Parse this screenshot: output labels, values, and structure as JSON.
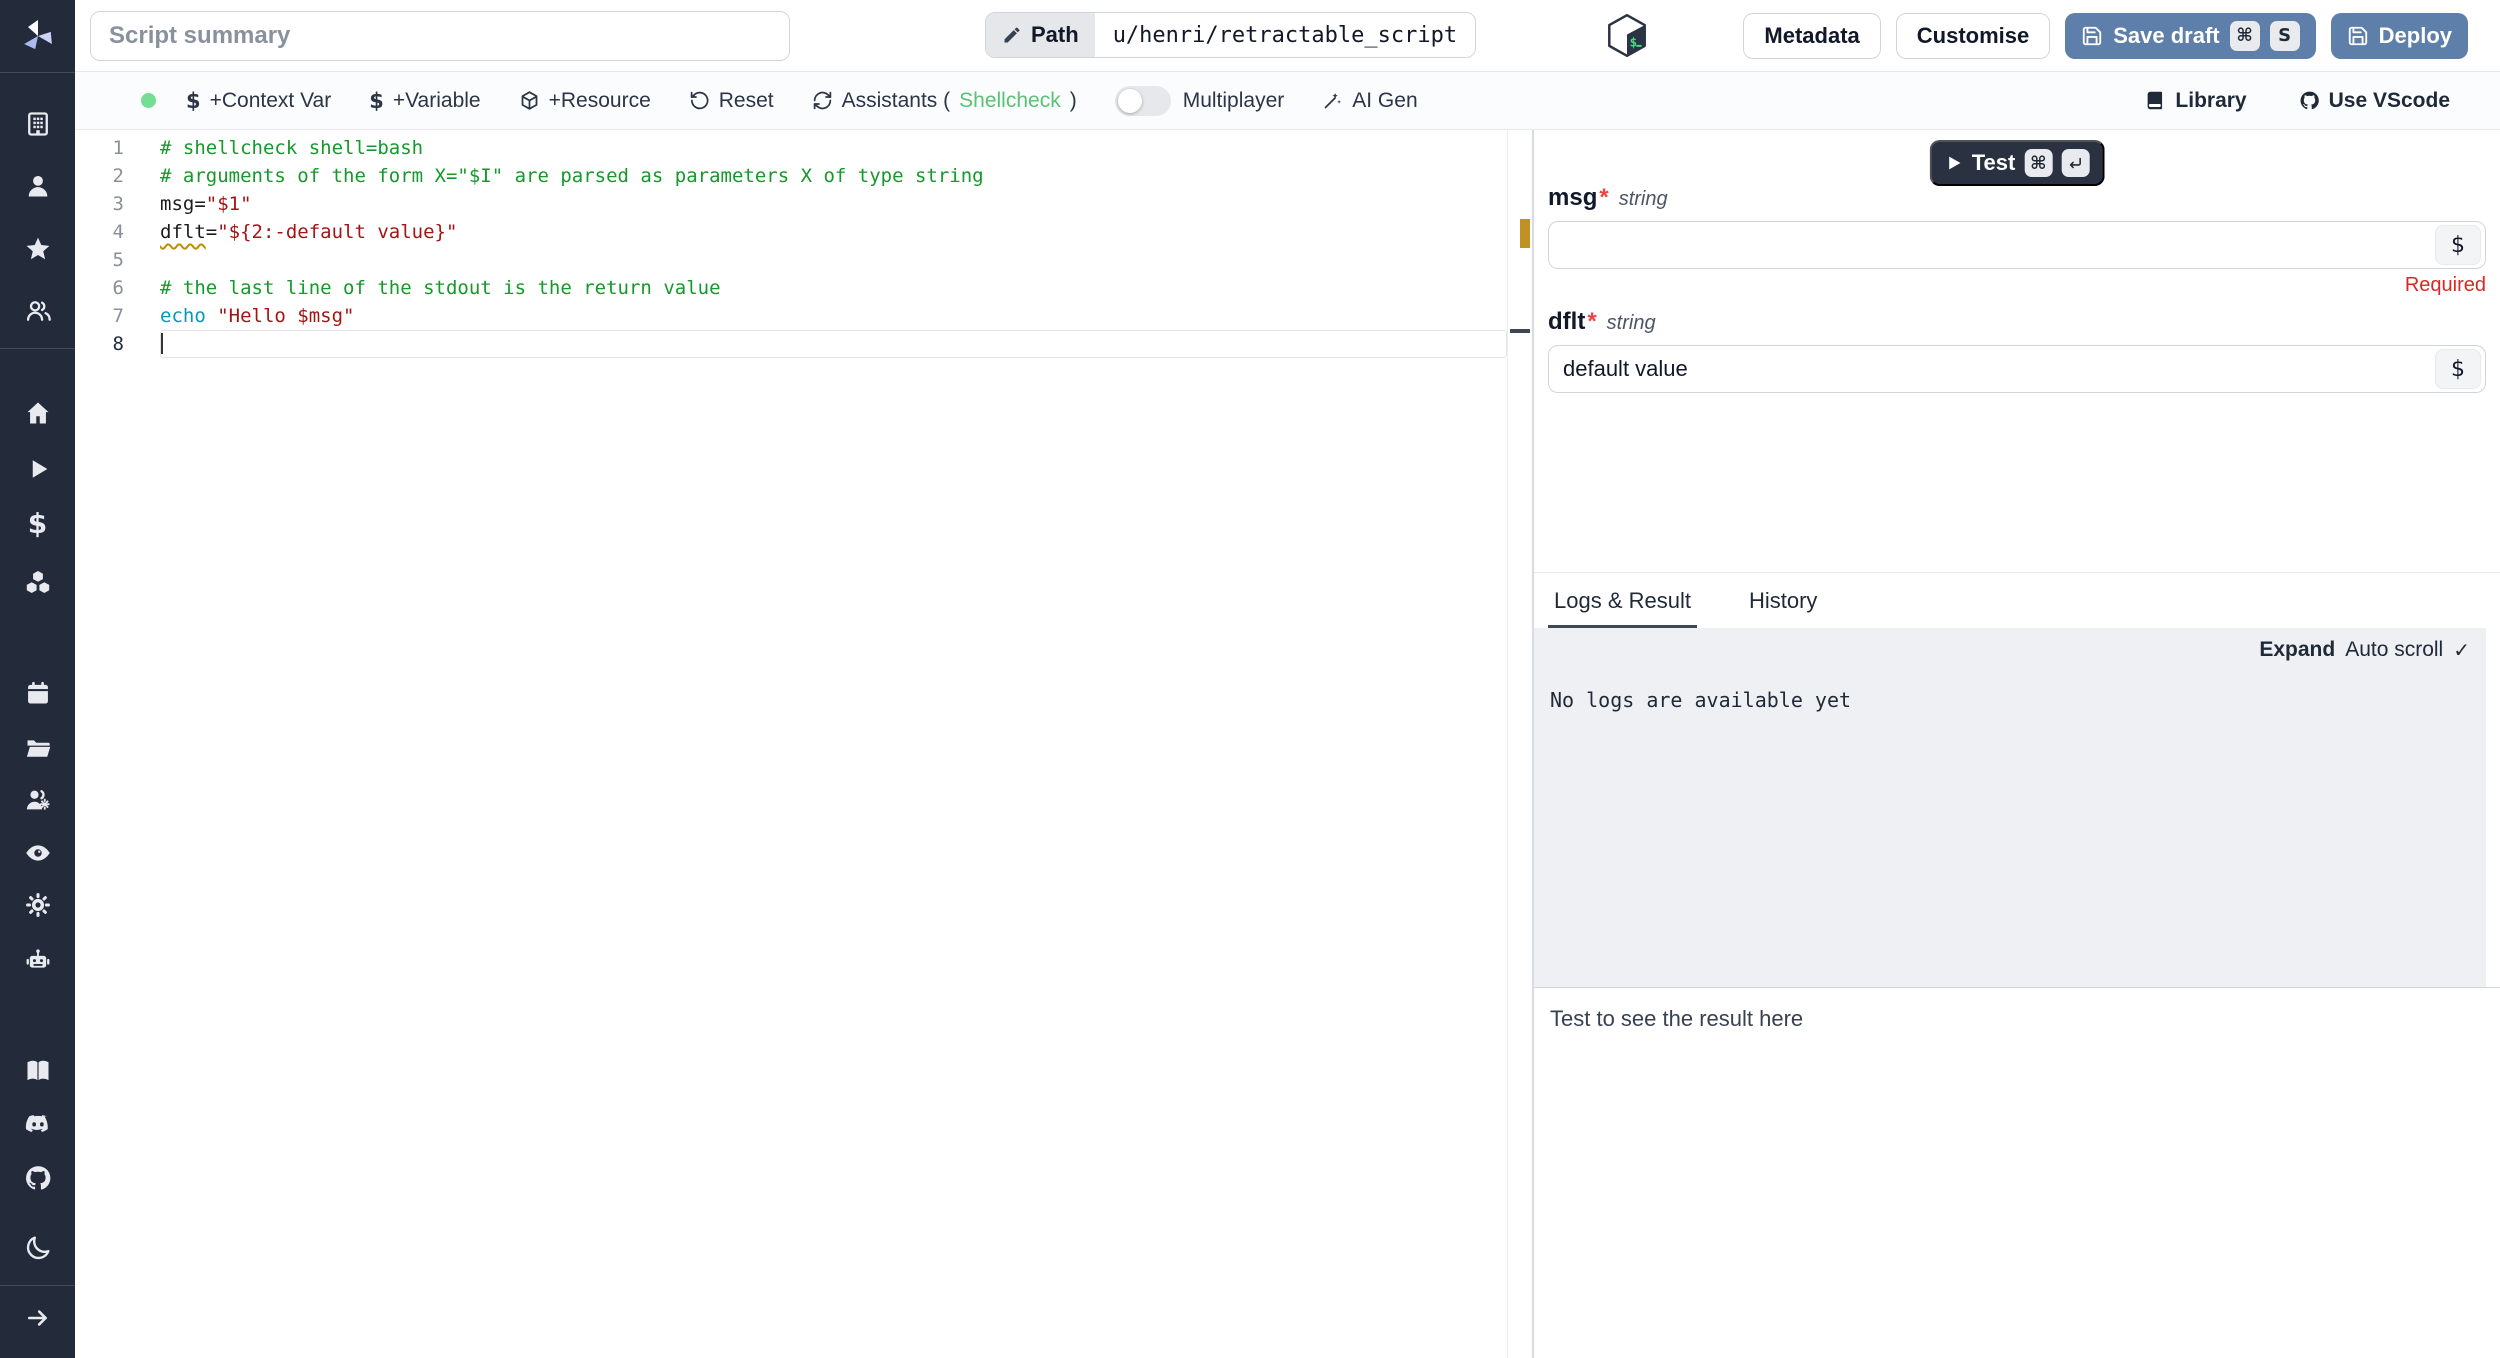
{
  "topbar": {
    "summary_placeholder": "Script summary",
    "path_label": "Path",
    "path_value": "u/henri/retractable_script",
    "metadata_label": "Metadata",
    "customise_label": "Customise",
    "save_draft_label": "Save draft",
    "deploy_label": "Deploy",
    "kbd_cmd": "⌘",
    "kbd_s": "S"
  },
  "toolbar": {
    "dollar_glyph": "$",
    "context_var_label": "+Context Var",
    "variable_label": "+Variable",
    "resource_label": "+Resource",
    "reset_label": "Reset",
    "assistants_prefix": "Assistants (",
    "assistants_name": "Shellcheck",
    "assistants_suffix": ")",
    "multiplayer_label": "Multiplayer",
    "ai_gen_label": "AI Gen",
    "library_label": "Library",
    "vscode_label": "Use VScode"
  },
  "editor": {
    "language": "bash",
    "line_numbers": [
      "1",
      "2",
      "3",
      "4",
      "5",
      "6",
      "7",
      "8"
    ],
    "lines": {
      "l1": "# shellcheck shell=bash",
      "l2": "# arguments of the form X=\"$I\" are parsed as parameters X of type string",
      "l3_var": "msg=",
      "l3_str": "\"$1\"",
      "l4_warn": "dflt",
      "l4_eq": "=",
      "l4_str": "\"${2:-default value}\"",
      "l6": "# the last line of the stdout is the return value",
      "l7_cmd": "echo",
      "l7_sp": " ",
      "l7_str": "\"Hello $msg\""
    }
  },
  "right_panel": {
    "test_label": "Test",
    "kbd_cmd": "⌘",
    "fields": {
      "msg_name": "msg",
      "msg_star": "*",
      "msg_type": "string",
      "msg_value": "",
      "msg_error": "Required",
      "dflt_name": "dflt",
      "dflt_star": "*",
      "dflt_type": "string",
      "dflt_value": "default value",
      "dollar": "$"
    },
    "tabs": {
      "logs": "Logs & Result",
      "history": "History"
    },
    "logs": {
      "expand_label": "Expand",
      "autoscroll_label": "Auto scroll",
      "check": "✓",
      "empty_text": "No logs are available yet"
    },
    "result_placeholder": "Test to see the result here"
  },
  "sidebar": {
    "icons": [
      "windmill-logo",
      "building",
      "user",
      "star",
      "users",
      "home",
      "play",
      "dollar",
      "boxes",
      "calendar",
      "folder",
      "user-group-gear",
      "eye",
      "gear",
      "robot",
      "book",
      "discord",
      "github",
      "moon",
      "arrow-right"
    ]
  },
  "colors": {
    "sidebar_bg": "#232a39",
    "accent_blue": "#5e7fa9",
    "test_dark": "#2a3140",
    "status_green": "#74de92",
    "shellcheck_green": "#59c275",
    "warning_amber": "#bf8f00",
    "error_red": "#dc2626",
    "comment_green": "#16982b",
    "string_red": "#a31515",
    "builtin_teal": "#0598bc"
  }
}
